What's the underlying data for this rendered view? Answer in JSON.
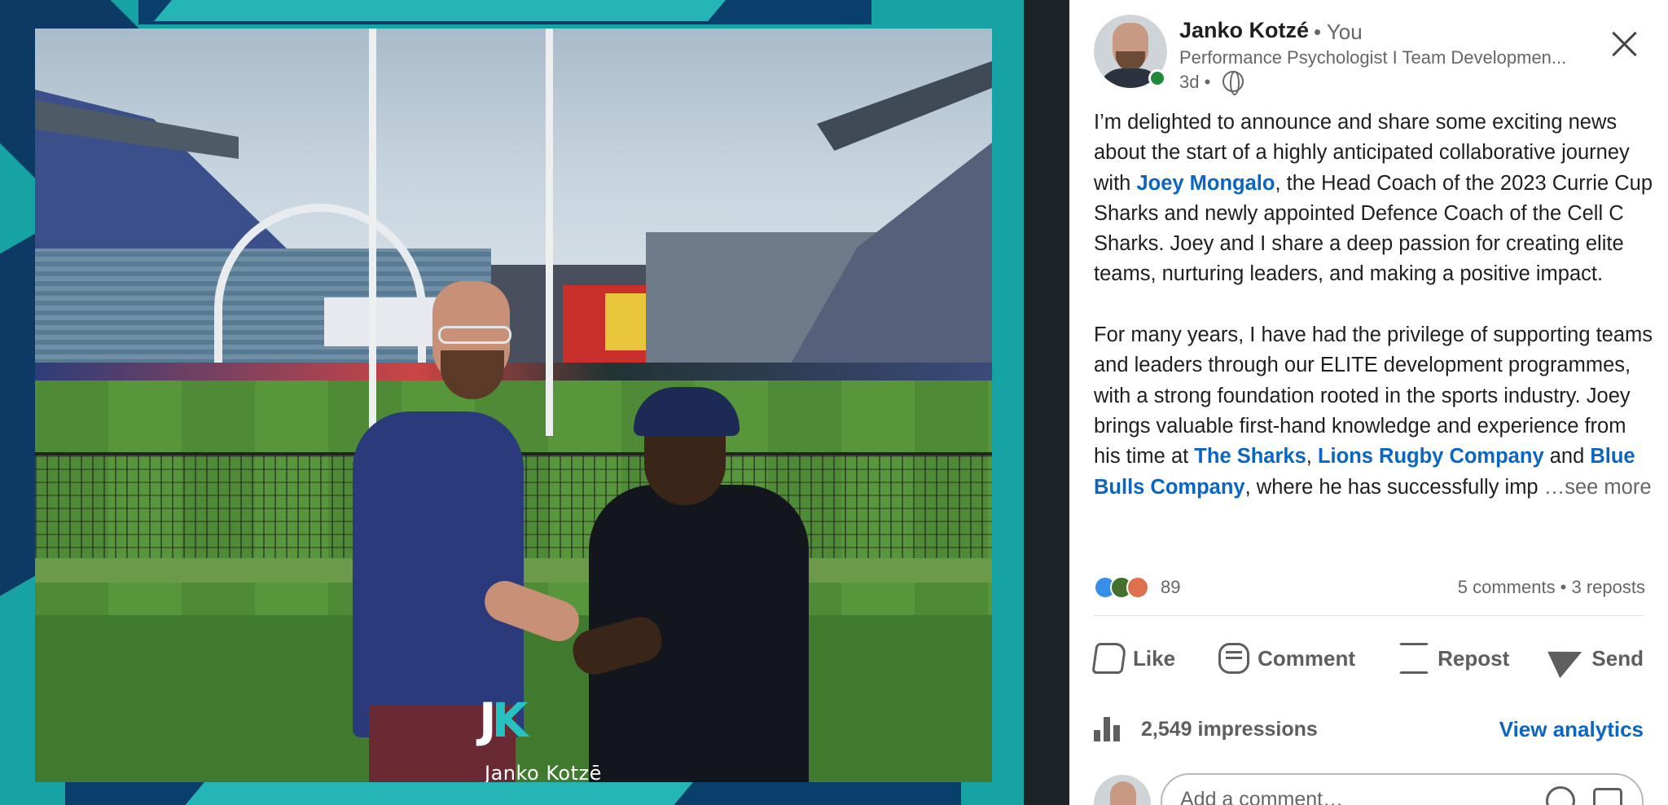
{
  "post": {
    "author_name": "Janko Kotzé",
    "author_relation": "• You",
    "headline": "Performance Psychologist I Team Developmen...",
    "time": "3d •",
    "globe_icon": "globe-icon",
    "close_icon": "close-icon"
  },
  "image": {
    "logo_mark": "JK",
    "logo_text": "Janko Kotzē"
  },
  "body": {
    "p1_a": "I’m delighted to announce and share some exciting news about the start of a highly anticipated collaborative journey with ",
    "p1_link": "Joey Mongalo",
    "p1_b": ", the Head Coach of the 2023 Currie Cup Sharks and newly appointed Defence Coach of the Cell C Sharks. Joey and I share a deep passion for creating elite teams, nurturing leaders, and making a positive impact.",
    "p2_a": "For many years, I have had the privilege of supporting teams and leaders through our ELITE development programmes, with a strong foundation rooted in the sports industry. Joey brings valuable first-hand knowledge and experience from his time at ",
    "p2_link1": "The Sharks",
    "p2_sep1": ", ",
    "p2_link2": "Lions Rugby Company",
    "p2_sep2": " and ",
    "p2_link3": "Blue Bulls Company",
    "p2_b": ", where he has successfully imp",
    "see_more": "  …see more"
  },
  "social": {
    "reaction_count": "89",
    "engagement": "5 comments • 3 reposts",
    "reaction_icons": [
      "like-icon",
      "celebrate-icon",
      "love-icon"
    ],
    "colors": {
      "like": "#378fe9",
      "celebrate": "#44712e",
      "love": "#df704d",
      "link": "#0a66c2"
    }
  },
  "actions": {
    "like": "Like",
    "comment": "Comment",
    "repost": "Repost",
    "send": "Send"
  },
  "stats": {
    "impressions": "2,549 impressions",
    "analytics": "View analytics"
  },
  "comment_box": {
    "placeholder": "Add a comment…"
  }
}
